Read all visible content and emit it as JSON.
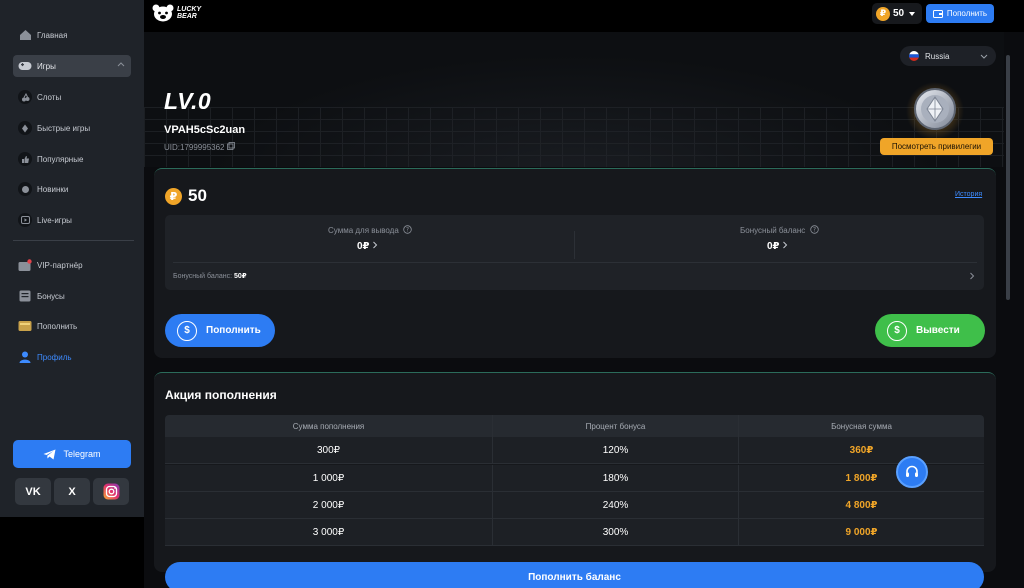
{
  "sidebar": {
    "items": [
      {
        "label": "Главная",
        "icon": "home-icon"
      },
      {
        "label": "Игры",
        "icon": "gamepad-icon"
      },
      {
        "label": "Слоты",
        "icon": "cherry-icon"
      },
      {
        "label": "Быстрые игры",
        "icon": "rocket-icon"
      },
      {
        "label": "Популярные",
        "icon": "thumbs-up-icon"
      },
      {
        "label": "Новинки",
        "icon": "new-icon"
      },
      {
        "label": "Live-игры",
        "icon": "live-icon"
      },
      {
        "label": "VIP-партнёр",
        "icon": "vip-icon"
      },
      {
        "label": "Бонусы",
        "icon": "gift-icon"
      },
      {
        "label": "Пополнить",
        "icon": "wallet-icon"
      },
      {
        "label": "Профиль",
        "icon": "user-icon"
      }
    ],
    "telegram_label": "Telegram",
    "social": [
      "VK",
      "X",
      "Instagram"
    ]
  },
  "header": {
    "logo_line1": "LUCKY",
    "logo_line2": "BEAR",
    "coin_symbol": "₽",
    "balance": "50",
    "topup_label": "Пополнить"
  },
  "profile": {
    "language": "Russia",
    "level": "LV.0",
    "username": "VPAH5cSc2uan",
    "uid": "UID:1799995362",
    "privileges_label": "Посмотреть привилегии"
  },
  "wallet": {
    "balance": "50",
    "history_label": "История",
    "withdraw_label": "Сумма для вывода",
    "withdraw_value": "0₽",
    "bonus_label": "Бонусный баланс",
    "bonus_value": "0₽",
    "bonus_line_label": "Бонусный баланс:",
    "bonus_line_value": "50₽",
    "deposit_button": "Пополнить",
    "withdraw_button": "Вывести"
  },
  "promo": {
    "title": "Акция пополнения",
    "columns": [
      "Сумма пополнения",
      "Процент бонуса",
      "Бонусная сумма"
    ],
    "rows": [
      [
        "300₽",
        "120%",
        "360₽"
      ],
      [
        "1 000₽",
        "180%",
        "1 800₽"
      ],
      [
        "2 000₽",
        "240%",
        "4 800₽"
      ],
      [
        "3 000₽",
        "300%",
        "9 000₽"
      ]
    ],
    "cta": "Пополнить баланс"
  },
  "colors": {
    "accent_blue": "#2d7cf3",
    "gold": "#f0a528",
    "green": "#3fbf4a"
  }
}
